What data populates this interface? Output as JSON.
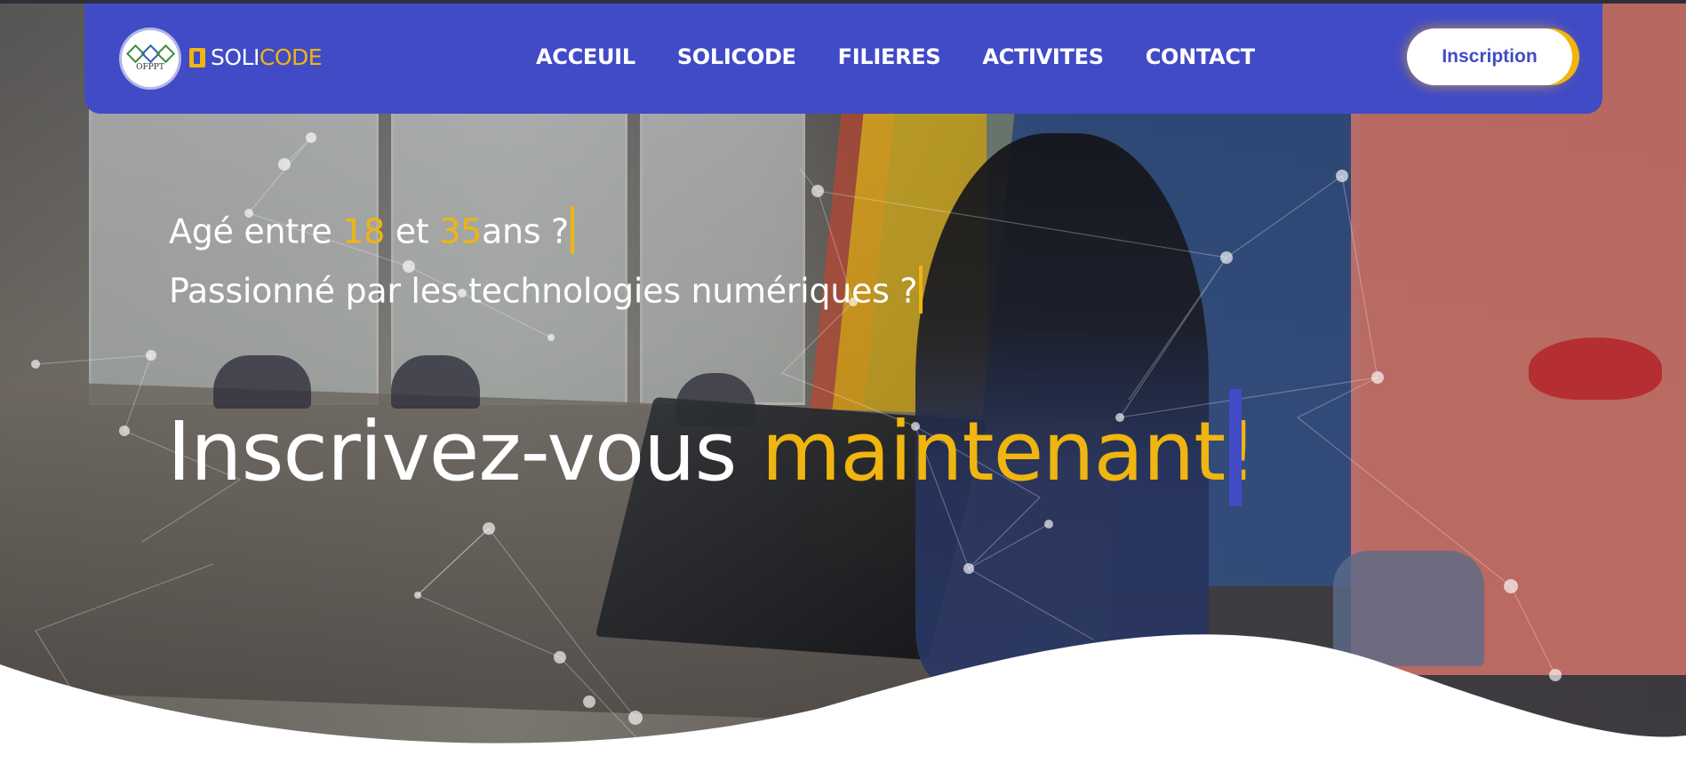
{
  "header": {
    "logo_text": "OFPPT",
    "brand_part1": "SOLI",
    "brand_part2": "CODE",
    "nav": [
      "ACCEUIL",
      "SOLICODE",
      "FILIERES",
      "ACTIVITES",
      "CONTACT"
    ],
    "signup_label": "Inscription"
  },
  "hero": {
    "line1_a": "Agé entre ",
    "line1_age_min": "18",
    "line1_b": " et ",
    "line1_age_max": "35",
    "line1_c": "ans ?",
    "line2": "Passionné par les technologies numériques ?",
    "headline_a": "Inscrivez-vous ",
    "headline_b": "maintenant!"
  },
  "colors": {
    "nav_bg": "#414bc6",
    "accent_yellow": "#f0b50f",
    "text_white": "#ffffff"
  },
  "icons": [
    "ofppt-logo-icon",
    "solicode-logo-icon"
  ]
}
